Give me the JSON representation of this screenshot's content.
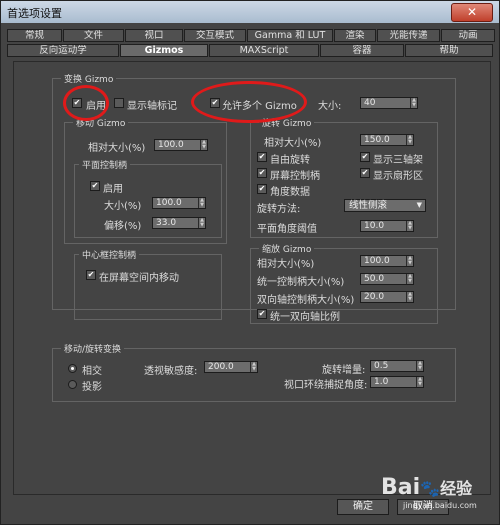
{
  "window": {
    "title": "首选项设置",
    "close_glyph": "✕"
  },
  "tabs_row1": [
    "常规",
    "文件",
    "视口",
    "交互模式",
    "Gamma 和 LUT",
    "渲染",
    "光能传递",
    "动画"
  ],
  "tabs_row2": [
    "反向运动学",
    "Gizmos",
    "MAXScript",
    "容器",
    "帮助"
  ],
  "active_tab": "Gizmos",
  "transform_gizmo": {
    "caption": "变换 Gizmo",
    "enable": {
      "label": "启用",
      "checked": true
    },
    "show_axis": {
      "label": "显示轴标记",
      "checked": false
    },
    "allow_multiple": {
      "label": "允许多个 Gizmo",
      "checked": true
    },
    "size_label": "大小:",
    "size_value": "40"
  },
  "move_gizmo": {
    "caption": "移动 Gizmo",
    "relative_size_label": "相对大小(%)",
    "relative_size_value": "100.0",
    "plane_handles": {
      "caption": "平面控制柄",
      "enable": {
        "label": "启用",
        "checked": true
      },
      "size_label": "大小(%)",
      "size_value": "100.0",
      "offset_label": "偏移(%)",
      "offset_value": "33.0"
    },
    "center_box": {
      "caption": "中心框控制柄",
      "screen_move": {
        "label": "在屏幕空间内移动",
        "checked": true
      }
    }
  },
  "rotate_gizmo": {
    "caption": "旋转 Gizmo",
    "relative_size_label": "相对大小(%)",
    "relative_size_value": "150.0",
    "free_rotate": {
      "label": "自由旋转",
      "checked": true
    },
    "show_3axis": {
      "label": "显示三轴架",
      "checked": true
    },
    "screen_handle": {
      "label": "屏幕控制柄",
      "checked": true
    },
    "show_sector": {
      "label": "显示扇形区",
      "checked": true
    },
    "angle_data": {
      "label": "角度数据",
      "checked": true
    },
    "method_label": "旋转方法:",
    "method_value": "线性侧滚",
    "plane_threshold_label": "平面角度阈值",
    "plane_threshold_value": "10.0"
  },
  "scale_gizmo": {
    "caption": "缩放 Gizmo",
    "relative_size_label": "相对大小(%)",
    "relative_size_value": "100.0",
    "uniform_size_label": "统一控制柄大小(%)",
    "uniform_size_value": "50.0",
    "dual_size_label": "双向轴控制柄大小(%)",
    "dual_size_value": "20.0",
    "uniform_dual": {
      "label": "统一双向轴比例",
      "checked": true
    }
  },
  "move_rotate": {
    "caption": "移动/旋转变换",
    "relative": {
      "label": "相交",
      "selected": true
    },
    "projection": {
      "label": "投影",
      "selected": false
    },
    "sensitivity_label": "透视敏感度:",
    "sensitivity_value": "200.0",
    "rotate_inc_label": "旋转增量:",
    "rotate_inc_value": "0.5",
    "snap_angle_label": "视口环绕捕捉角度:",
    "snap_angle_value": "1.0"
  },
  "footer": {
    "ok_label": "确定",
    "cancel_label": "取消"
  },
  "watermark": {
    "brand": "Bai",
    "paw": "🐾",
    "suffix": "经验",
    "sub": "jingyan.baidu.com"
  },
  "colors": {
    "annotation": "#e01a1a",
    "panel_bg": "#444444"
  }
}
